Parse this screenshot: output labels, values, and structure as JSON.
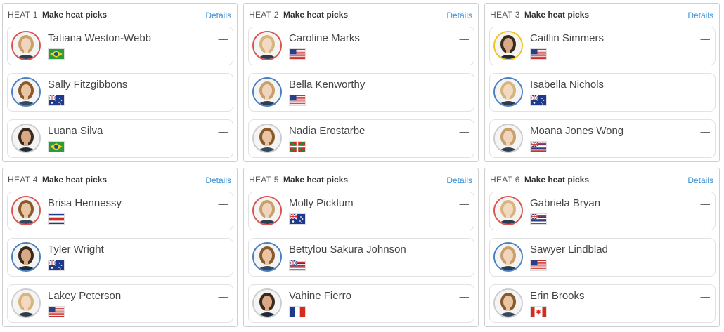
{
  "colors": {
    "jersey_red": "#d9534f",
    "jersey_blue": "#4a7fc1",
    "jersey_yellow": "#f0c419",
    "jersey_white": "#cccccc",
    "link": "#3a8fd6"
  },
  "heats": [
    {
      "label": "HEAT 1",
      "cta": "Make heat picks",
      "details": "Details",
      "surfers": [
        {
          "name": "Tatiana Weston-Webb",
          "flag": "brazil",
          "jersey": "red",
          "score": "––"
        },
        {
          "name": "Sally Fitzgibbons",
          "flag": "australia",
          "jersey": "blue",
          "score": "––"
        },
        {
          "name": "Luana Silva",
          "flag": "brazil",
          "jersey": "white",
          "score": "––"
        }
      ]
    },
    {
      "label": "HEAT 2",
      "cta": "Make heat picks",
      "details": "Details",
      "surfers": [
        {
          "name": "Caroline Marks",
          "flag": "usa",
          "jersey": "red",
          "score": "––"
        },
        {
          "name": "Bella Kenworthy",
          "flag": "usa",
          "jersey": "blue",
          "score": "––"
        },
        {
          "name": "Nadia Erostarbe",
          "flag": "basque",
          "jersey": "white",
          "score": "––"
        }
      ]
    },
    {
      "label": "HEAT 3",
      "cta": "Make heat picks",
      "details": "Details",
      "surfers": [
        {
          "name": "Caitlin Simmers",
          "flag": "usa",
          "jersey": "yellow",
          "score": "––"
        },
        {
          "name": "Isabella Nichols",
          "flag": "australia",
          "jersey": "blue",
          "score": "––"
        },
        {
          "name": "Moana Jones Wong",
          "flag": "hawaii",
          "jersey": "white",
          "score": "––"
        }
      ]
    },
    {
      "label": "HEAT 4",
      "cta": "Make heat picks",
      "details": "Details",
      "surfers": [
        {
          "name": "Brisa Hennessy",
          "flag": "costa-rica",
          "jersey": "red",
          "score": "––"
        },
        {
          "name": "Tyler Wright",
          "flag": "australia",
          "jersey": "blue",
          "score": "––"
        },
        {
          "name": "Lakey Peterson",
          "flag": "usa",
          "jersey": "white",
          "score": "––"
        }
      ]
    },
    {
      "label": "HEAT 5",
      "cta": "Make heat picks",
      "details": "Details",
      "surfers": [
        {
          "name": "Molly Picklum",
          "flag": "australia",
          "jersey": "red",
          "score": "––"
        },
        {
          "name": "Bettylou Sakura Johnson",
          "flag": "hawaii",
          "jersey": "blue",
          "score": "––"
        },
        {
          "name": "Vahine Fierro",
          "flag": "france",
          "jersey": "white",
          "score": "––"
        }
      ]
    },
    {
      "label": "HEAT 6",
      "cta": "Make heat picks",
      "details": "Details",
      "surfers": [
        {
          "name": "Gabriela Bryan",
          "flag": "hawaii",
          "jersey": "red",
          "score": "––"
        },
        {
          "name": "Sawyer Lindblad",
          "flag": "usa",
          "jersey": "blue",
          "score": "––"
        },
        {
          "name": "Erin Brooks",
          "flag": "canada",
          "jersey": "white",
          "score": "––"
        }
      ]
    }
  ]
}
